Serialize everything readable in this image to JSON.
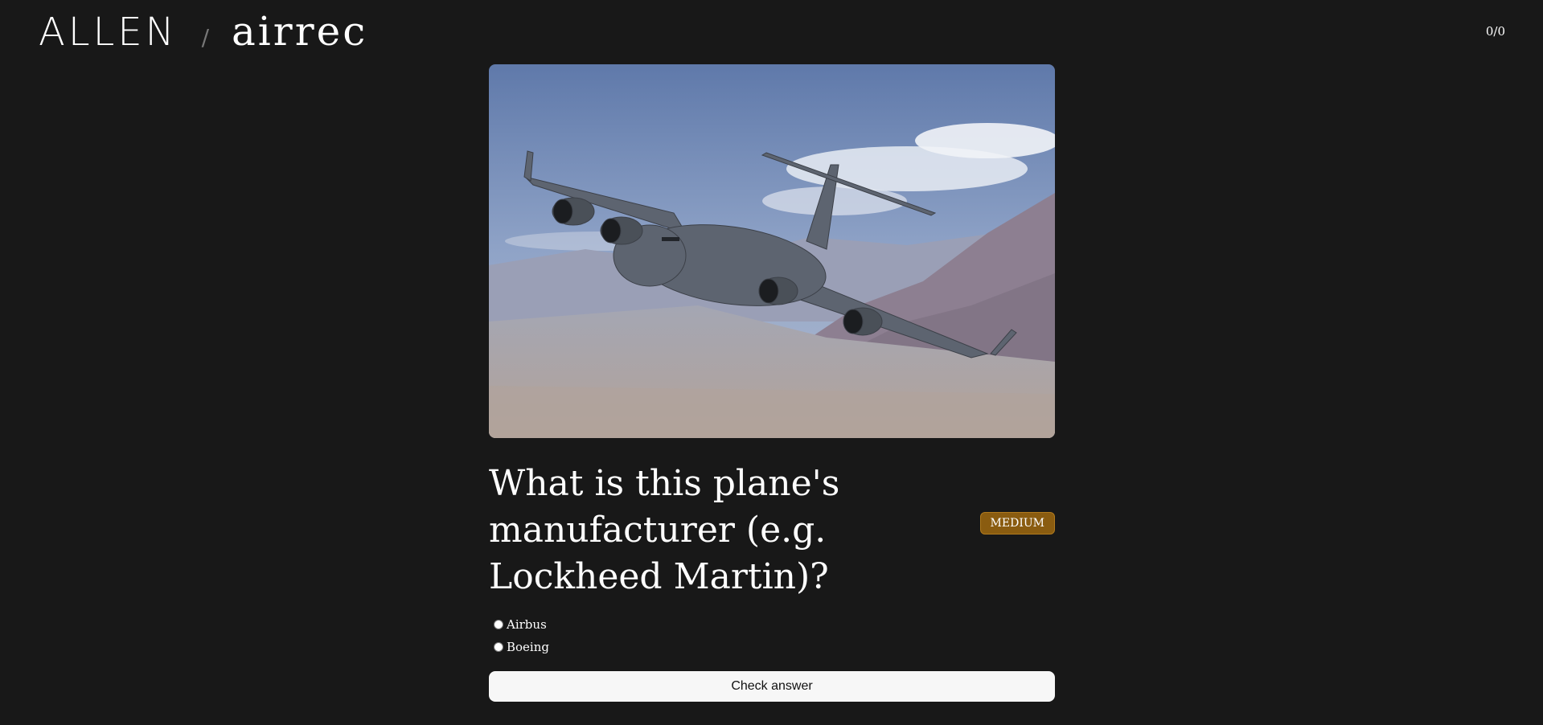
{
  "header": {
    "brand_primary": "ALLEN",
    "brand_separator": "/",
    "brand_app": "airrec",
    "score": "0/0"
  },
  "quiz": {
    "image_alt": "Aircraft in flight over desert mountains",
    "question": "What is this plane's manufacturer (e.g. Lockheed Martin)?",
    "difficulty": "MEDIUM",
    "options": [
      {
        "label": "Airbus",
        "selected": false
      },
      {
        "label": "Boeing",
        "selected": false
      }
    ],
    "submit_label": "Check answer"
  },
  "colors": {
    "background": "#181818",
    "badge": "#8a5c10",
    "button": "#f7f7f7"
  }
}
